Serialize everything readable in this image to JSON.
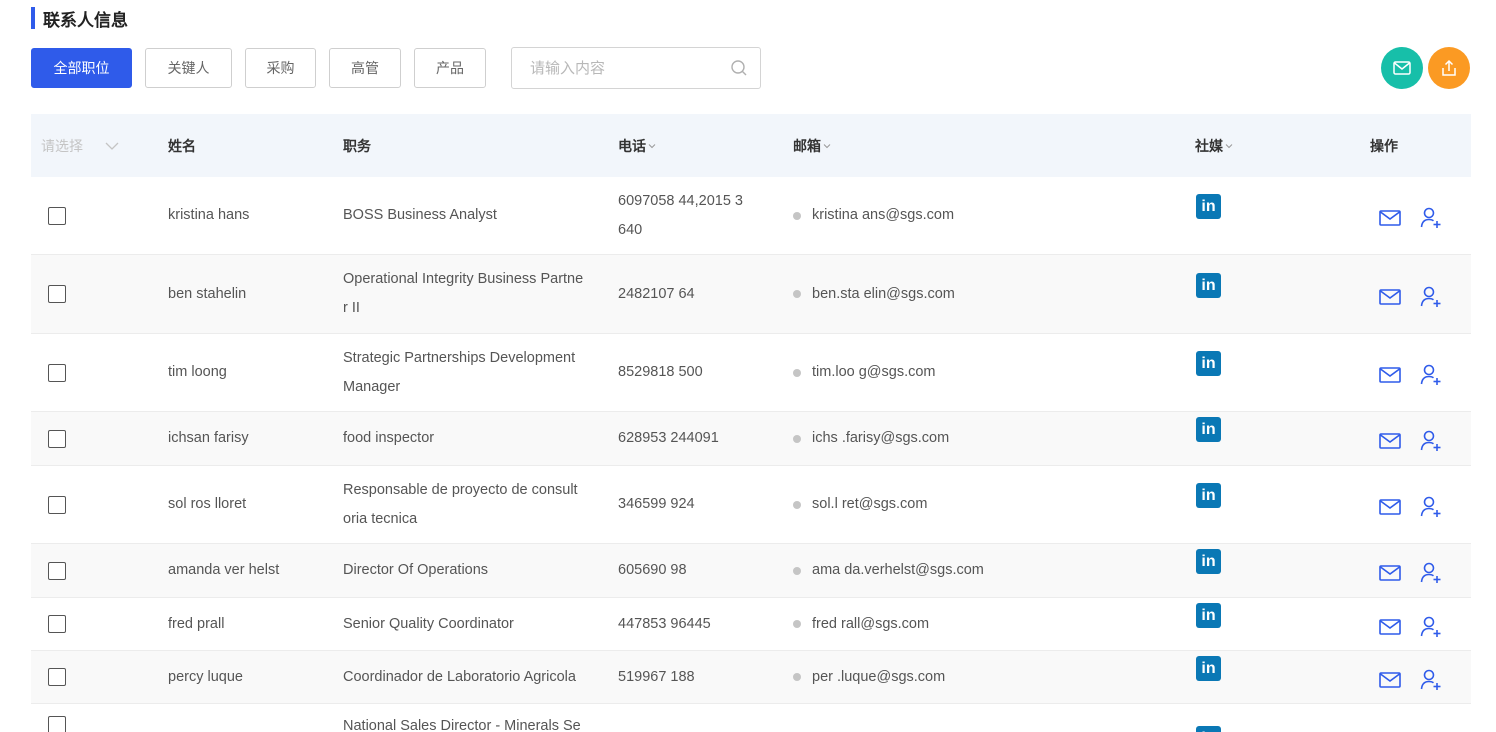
{
  "section": {
    "title": "联系人信息"
  },
  "filters": [
    {
      "label": "全部职位",
      "active": true
    },
    {
      "label": "关键人",
      "active": false
    },
    {
      "label": "采购",
      "active": false
    },
    {
      "label": "高管",
      "active": false
    },
    {
      "label": "产品",
      "active": false
    }
  ],
  "search": {
    "placeholder": "请输入内容",
    "value": ""
  },
  "actions": {
    "mail_icon": "mail-icon",
    "export_icon": "export-icon",
    "mail_color": "#17bfa9",
    "export_color": "#fb9a23"
  },
  "colors": {
    "accent": "#2f5bea",
    "linkedin": "#0a78b5",
    "header_bg": "#f2f6fb"
  },
  "table": {
    "headers": {
      "select": "请选择",
      "name": "姓名",
      "title": "职务",
      "phone": "电话",
      "email": "邮箱",
      "social": "社媒",
      "ops": "操作"
    },
    "rows": [
      {
        "name": "kristina hans",
        "title": "BOSS Business Analyst",
        "phone": "6097058  44,2015  3\n640",
        "email": "kristina  ans@sgs.com"
      },
      {
        "name": "ben stahelin",
        "title": "Operational Integrity Business Partne\nr II",
        "phone": "2482107  64",
        "email": "ben.sta  elin@sgs.com"
      },
      {
        "name": "tim loong",
        "title": "Strategic Partnerships Development\nManager",
        "phone": "8529818  500",
        "email": "tim.loo  g@sgs.com"
      },
      {
        "name": "ichsan farisy",
        "title": "food inspector",
        "phone": "628953  244091",
        "email": "ichs  .farisy@sgs.com"
      },
      {
        "name": "sol ros lloret",
        "title": "Responsable de proyecto de consult\noria tecnica",
        "phone": "346599  924",
        "email": "sol.l  ret@sgs.com"
      },
      {
        "name": "amanda ver helst",
        "title": "Director Of Operations",
        "phone": "605690  98",
        "email": "ama  da.verhelst@sgs.com"
      },
      {
        "name": "fred prall",
        "title": "Senior Quality Coordinator",
        "phone": "447853  96445",
        "email": "fred  rall@sgs.com"
      },
      {
        "name": "percy luque",
        "title": "Coordinador de Laboratorio Agricola",
        "phone": "519967  188",
        "email": "per  .luque@sgs.com"
      },
      {
        "name": "",
        "title": "National Sales Director - Minerals Se",
        "phone": "",
        "email": ""
      }
    ]
  }
}
